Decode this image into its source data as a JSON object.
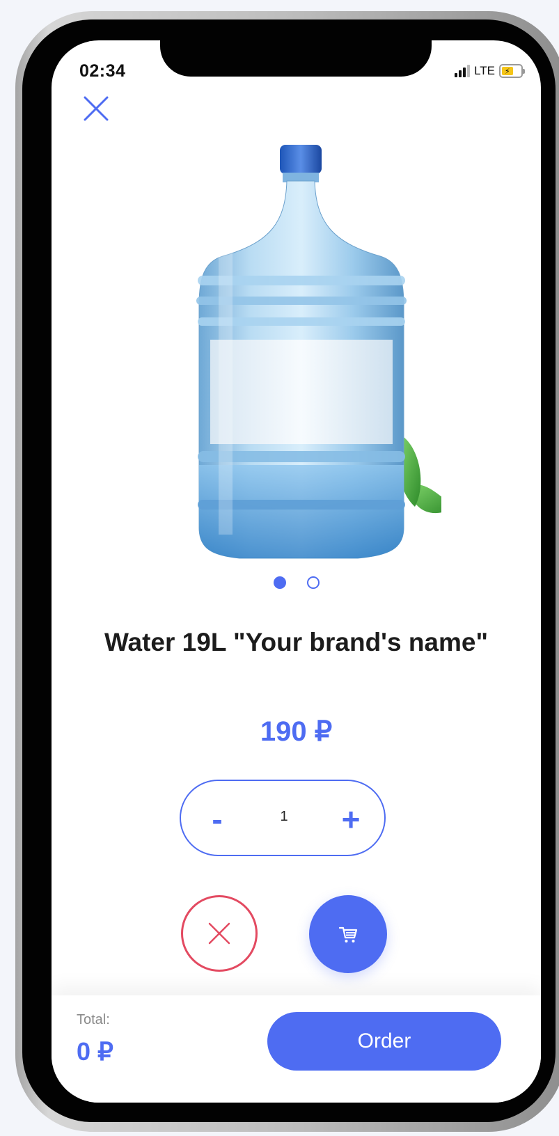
{
  "status_bar": {
    "time": "02:34",
    "network": "LTE",
    "signal_icon": "signal-bars-icon",
    "battery_icon": "battery-charging-icon"
  },
  "header": {
    "close_icon": "close-icon"
  },
  "carousel": {
    "image_icon": "water-bottle-19l-image",
    "slides_count": 2,
    "active_slide": 1
  },
  "product": {
    "title": "Water 19L \"Your brand's name\"",
    "price": "190 ₽"
  },
  "stepper": {
    "minus_label": "-",
    "value": "1",
    "plus_label": "+"
  },
  "actions": {
    "remove_icon": "close-icon",
    "cart_icon": "cart-icon"
  },
  "footer": {
    "total_label": "Total:",
    "total_value": "0 ₽",
    "order_label": "Order"
  },
  "colors": {
    "accent": "#4e6cf2",
    "danger": "#e34a61",
    "title_text": "#1c1c1c",
    "muted_text": "#8a8a8a",
    "background": "#f3f5fa"
  }
}
